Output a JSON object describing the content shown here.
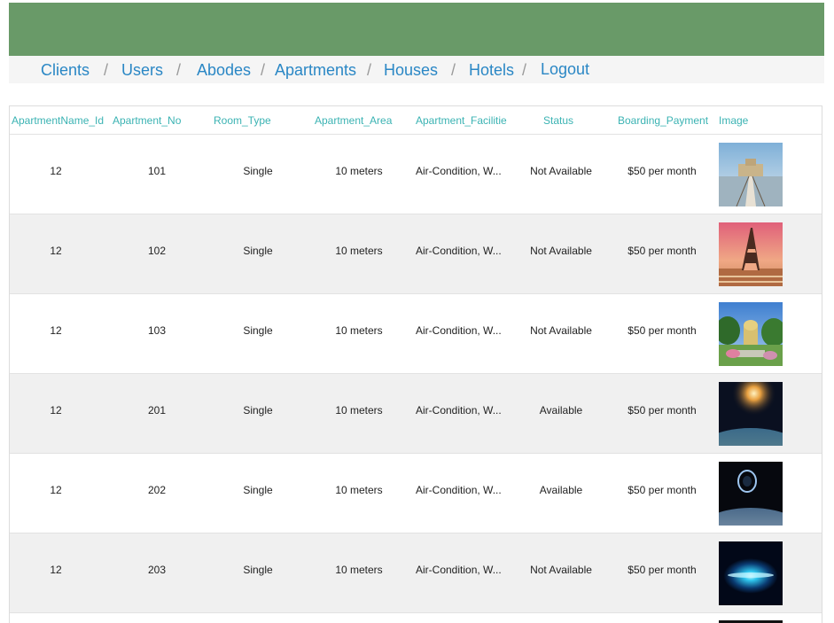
{
  "nav": {
    "items": [
      "Clients",
      "Users",
      "Abodes",
      "Apartments",
      "Houses",
      "Hotels",
      "Logout"
    ],
    "separator": "/"
  },
  "table": {
    "headers": [
      "ApartmentName_Id",
      "Apartment_No",
      "Room_Type",
      "Apartment_Area",
      "Apartment_Facilitie",
      "Status",
      "Boarding_Payment",
      "Image"
    ],
    "rows": [
      {
        "name_id": "12",
        "no": "101",
        "room_type": "Single",
        "area": "10 meters",
        "facilities": "Air-Condition, W...",
        "status": "Not Available",
        "payment": "$50 per month",
        "image": "pier-photo"
      },
      {
        "name_id": "12",
        "no": "102",
        "room_type": "Single",
        "area": "10 meters",
        "facilities": "Air-Condition, W...",
        "status": "Not Available",
        "payment": "$50 per month",
        "image": "eiffel-tower-photo"
      },
      {
        "name_id": "12",
        "no": "103",
        "room_type": "Single",
        "area": "10 meters",
        "facilities": "Air-Condition, W...",
        "status": "Not Available",
        "payment": "$50 per month",
        "image": "palace-garden-photo"
      },
      {
        "name_id": "12",
        "no": "201",
        "room_type": "Single",
        "area": "10 meters",
        "facilities": "Air-Condition, W...",
        "status": "Available",
        "payment": "$50 per month",
        "image": "space-sunrise-photo"
      },
      {
        "name_id": "12",
        "no": "202",
        "room_type": "Single",
        "area": "10 meters",
        "facilities": "Air-Condition, W...",
        "status": "Available",
        "payment": "$50 per month",
        "image": "space-ring-photo"
      },
      {
        "name_id": "12",
        "no": "203",
        "room_type": "Single",
        "area": "10 meters",
        "facilities": "Air-Condition, W...",
        "status": "Not Available",
        "payment": "$50 per month",
        "image": "galaxy-glow-photo"
      }
    ]
  },
  "colors": {
    "banner": "#699a68",
    "link": "#2a87c5",
    "header_text": "#3bb3b3",
    "row_alt": "#f0f0f0"
  }
}
